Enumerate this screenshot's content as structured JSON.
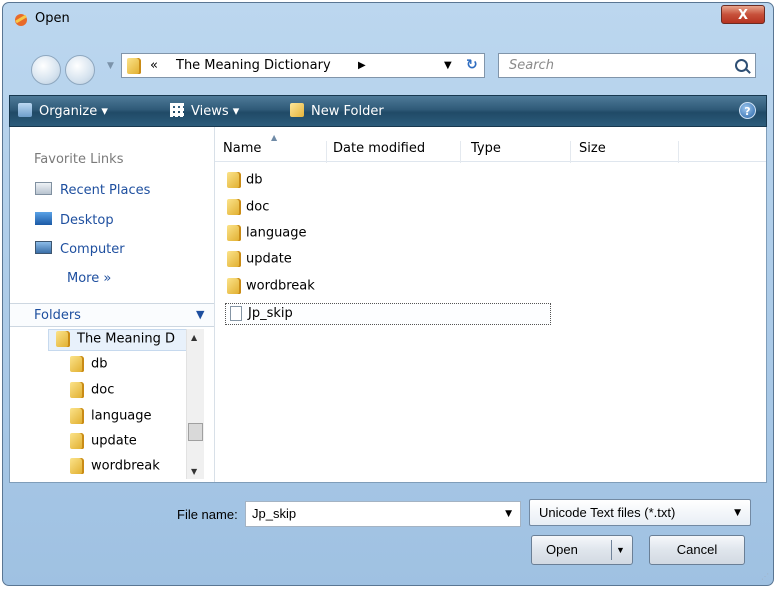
{
  "window": {
    "title": "Open",
    "close_label": "X"
  },
  "address": {
    "overflow": "«",
    "path": "The Meaning Dictionary",
    "separator": "▶"
  },
  "search": {
    "placeholder": "Search"
  },
  "toolbar": {
    "organize": "Organize ▾",
    "views": "Views ▾",
    "new_folder": "New Folder",
    "help": "?"
  },
  "favorites": {
    "header": "Favorite Links",
    "items": [
      {
        "label": "Recent Places",
        "icon": "recent-places-icon"
      },
      {
        "label": "Desktop",
        "icon": "desktop-icon"
      },
      {
        "label": "Computer",
        "icon": "computer-icon"
      }
    ],
    "more": "More »"
  },
  "folders": {
    "label": "Folders",
    "root": "The Meaning D",
    "children": [
      "db",
      "doc",
      "language",
      "update",
      "wordbreak"
    ]
  },
  "columns": [
    "Name",
    "Date modified",
    "Type",
    "Size"
  ],
  "files": [
    {
      "name": "db",
      "kind": "folder"
    },
    {
      "name": "doc",
      "kind": "folder"
    },
    {
      "name": "language",
      "kind": "folder"
    },
    {
      "name": "update",
      "kind": "folder"
    },
    {
      "name": "wordbreak",
      "kind": "folder"
    },
    {
      "name": "Jp_skip",
      "kind": "file",
      "selected": true
    }
  ],
  "file_name": {
    "label": "File name:",
    "value": "Jp_skip"
  },
  "file_type": {
    "value": "Unicode Text files (*.txt)"
  },
  "buttons": {
    "open": "Open",
    "cancel": "Cancel"
  },
  "colors": {
    "toolbar": "#2f5a78",
    "link": "#1e4f9f",
    "frame": "#9fc1e2"
  }
}
